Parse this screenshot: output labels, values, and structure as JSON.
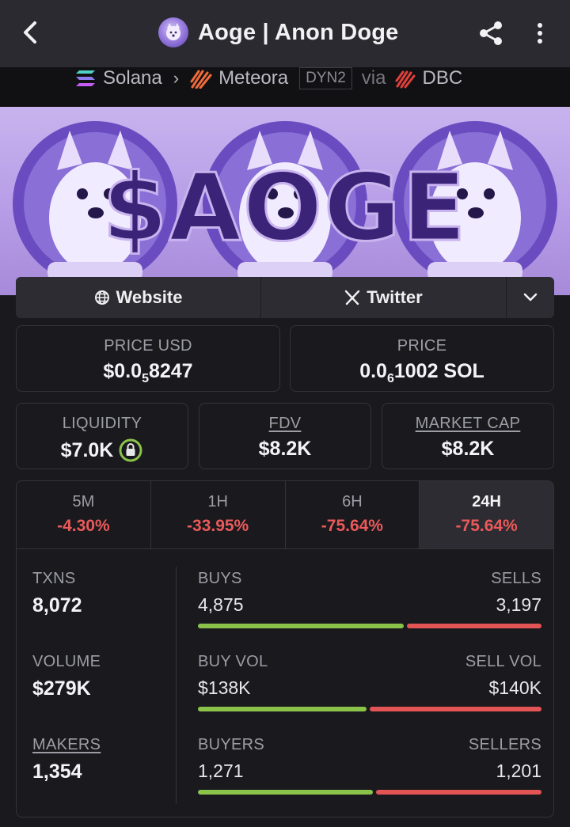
{
  "header": {
    "title": "Aoge | Anon Doge"
  },
  "route": {
    "chain": "Solana",
    "dex": "Meteora",
    "pair_version": "DYN2",
    "via": "via",
    "launchpad": "DBC"
  },
  "banner": {
    "ticker_art": "$AOGE"
  },
  "links": {
    "website": "Website",
    "twitter": "Twitter"
  },
  "price": {
    "usd_label": "PRICE USD",
    "usd_prefix": "$0.0",
    "usd_zeros": "5",
    "usd_digits": "8247",
    "native_label": "PRICE",
    "native_prefix": "0.0",
    "native_zeros": "6",
    "native_digits": "1002 SOL"
  },
  "metrics": {
    "liquidity_label": "LIQUIDITY",
    "liquidity_value": "$7.0K",
    "fdv_label": "FDV",
    "fdv_value": "$8.2K",
    "mcap_label": "MARKET CAP",
    "mcap_value": "$8.2K"
  },
  "timeframes": [
    {
      "label": "5M",
      "change": "-4.30%"
    },
    {
      "label": "1H",
      "change": "-33.95%"
    },
    {
      "label": "6H",
      "change": "-75.64%"
    },
    {
      "label": "24H",
      "change": "-75.64%"
    }
  ],
  "active_timeframe": "24H",
  "stats": {
    "txns_label": "TXNS",
    "txns_value": "8,072",
    "volume_label": "VOLUME",
    "volume_value": "$279K",
    "makers_label": "MAKERS",
    "makers_value": "1,354",
    "buys_label": "BUYS",
    "buys_value": "4,875",
    "sells_label": "SELLS",
    "sells_value": "3,197",
    "buys_ratio": 0.604,
    "buy_vol_label": "BUY VOL",
    "buy_vol_value": "$138K",
    "sell_vol_label": "SELL VOL",
    "sell_vol_value": "$140K",
    "vol_ratio": 0.496,
    "buyers_label": "BUYERS",
    "buyers_value": "1,271",
    "sellers_label": "SELLERS",
    "sellers_value": "1,201",
    "buyers_ratio": 0.514
  },
  "colors": {
    "positive": "#8bc34a",
    "negative": "#e35454",
    "accent_purple": "#5a3aa8"
  }
}
